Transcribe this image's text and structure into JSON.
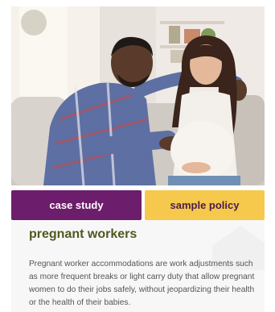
{
  "buttons": {
    "case_study": "case study",
    "sample_policy": "sample policy"
  },
  "section": {
    "heading": "pregnant workers",
    "body": "Pregnant worker accommodations are work adjustments such as more frequent breaks or light carry duty that allow pregnant women to do their jobs safely, without jeopardizing their health or the health of their babies."
  },
  "colors": {
    "case_study_bg": "#6c1d6b",
    "sample_policy_bg": "#f6c84c",
    "heading": "#4d5a1e"
  }
}
